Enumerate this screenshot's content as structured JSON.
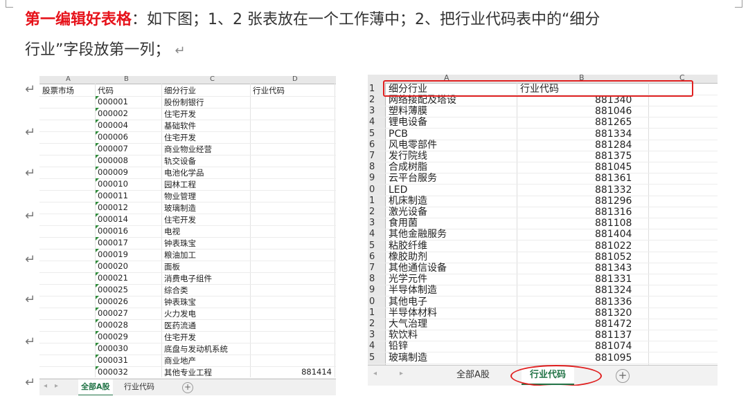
{
  "doc": {
    "line1_highlight": "第一编辑好表格",
    "line1_rest": "：如下图；1、2 张表放在一个工作薄中；2、把行业代码表中的“细分",
    "line2": "行业”字段放第一列；",
    "para_mark": "↵"
  },
  "sheet1": {
    "col_letters": [
      "A",
      "B",
      "C",
      "D"
    ],
    "headers": [
      "股票市场",
      "代码",
      "细分行业",
      "行业代码"
    ],
    "rows": [
      {
        "code": "000001",
        "industry": "股份制银行",
        "indcode": ""
      },
      {
        "code": "000002",
        "industry": "住宅开发",
        "indcode": ""
      },
      {
        "code": "000004",
        "industry": "基础软件",
        "indcode": ""
      },
      {
        "code": "000006",
        "industry": "住宅开发",
        "indcode": ""
      },
      {
        "code": "000007",
        "industry": "商业物业经营",
        "indcode": ""
      },
      {
        "code": "000008",
        "industry": "轨交设备",
        "indcode": ""
      },
      {
        "code": "000009",
        "industry": "电池化学品",
        "indcode": ""
      },
      {
        "code": "000010",
        "industry": "园林工程",
        "indcode": ""
      },
      {
        "code": "000011",
        "industry": "物业管理",
        "indcode": ""
      },
      {
        "code": "000012",
        "industry": "玻璃制造",
        "indcode": ""
      },
      {
        "code": "000014",
        "industry": "住宅开发",
        "indcode": ""
      },
      {
        "code": "000016",
        "industry": "电视",
        "indcode": ""
      },
      {
        "code": "000017",
        "industry": "钟表珠宝",
        "indcode": ""
      },
      {
        "code": "000019",
        "industry": "粮油加工",
        "indcode": ""
      },
      {
        "code": "000020",
        "industry": "面板",
        "indcode": ""
      },
      {
        "code": "000021",
        "industry": "消费电子组件",
        "indcode": ""
      },
      {
        "code": "000025",
        "industry": "综合类",
        "indcode": ""
      },
      {
        "code": "000026",
        "industry": "钟表珠宝",
        "indcode": ""
      },
      {
        "code": "000027",
        "industry": "火力发电",
        "indcode": ""
      },
      {
        "code": "000028",
        "industry": "医药流通",
        "indcode": ""
      },
      {
        "code": "000029",
        "industry": "住宅开发",
        "indcode": ""
      },
      {
        "code": "000030",
        "industry": "底盘与发动机系统",
        "indcode": ""
      },
      {
        "code": "000031",
        "industry": "商业地产",
        "indcode": ""
      },
      {
        "code": "000032",
        "industry": "其他专业工程",
        "indcode": "881414"
      }
    ],
    "tabs": [
      "全部A股",
      "行业代码"
    ],
    "active_tab": 0
  },
  "sheet2": {
    "col_letters": [
      "A",
      "B",
      "C"
    ],
    "row_numbers": [
      "1",
      "2",
      "3",
      "4",
      "5",
      "6",
      "7",
      "8",
      "9",
      "0",
      "1",
      "2",
      "3",
      "4",
      "5",
      "6",
      "7",
      "8",
      "9",
      "0",
      "1",
      "2",
      "3",
      "4",
      "5"
    ],
    "headers": [
      "细分行业",
      "行业代码"
    ],
    "rows": [
      {
        "name": "网络接配及塔设",
        "code": "881340"
      },
      {
        "name": "塑料薄膜",
        "code": "881046"
      },
      {
        "name": "锂电设备",
        "code": "881265"
      },
      {
        "name": "PCB",
        "code": "881334"
      },
      {
        "name": "风电零部件",
        "code": "881284"
      },
      {
        "name": "发行院线",
        "code": "881375"
      },
      {
        "name": "合成树脂",
        "code": "881045"
      },
      {
        "name": "云平台服务",
        "code": "881361"
      },
      {
        "name": "LED",
        "code": "881332"
      },
      {
        "name": "机床制造",
        "code": "881296"
      },
      {
        "name": "激光设备",
        "code": "881316"
      },
      {
        "name": "食用菌",
        "code": "881108"
      },
      {
        "name": "其他金融服务",
        "code": "881404"
      },
      {
        "name": "粘胶纤维",
        "code": "881022"
      },
      {
        "name": "橡胶助剂",
        "code": "881052"
      },
      {
        "name": "其他通信设备",
        "code": "881343"
      },
      {
        "name": "光学元件",
        "code": "881331"
      },
      {
        "name": "半导体制造",
        "code": "881324"
      },
      {
        "name": "其他电子",
        "code": "881336"
      },
      {
        "name": "半导体材料",
        "code": "881320"
      },
      {
        "name": "大气治理",
        "code": "881472"
      },
      {
        "name": "软饮料",
        "code": "881137"
      },
      {
        "name": "铅锌",
        "code": "881074"
      },
      {
        "name": "玻璃制造",
        "code": "881095"
      }
    ],
    "tabs": [
      "全部A股",
      "行业代码"
    ],
    "active_tab": 1
  },
  "colors": {
    "highlight_red": "#e6121a",
    "excel_green": "#217346",
    "annotation_red": "#e02020"
  }
}
